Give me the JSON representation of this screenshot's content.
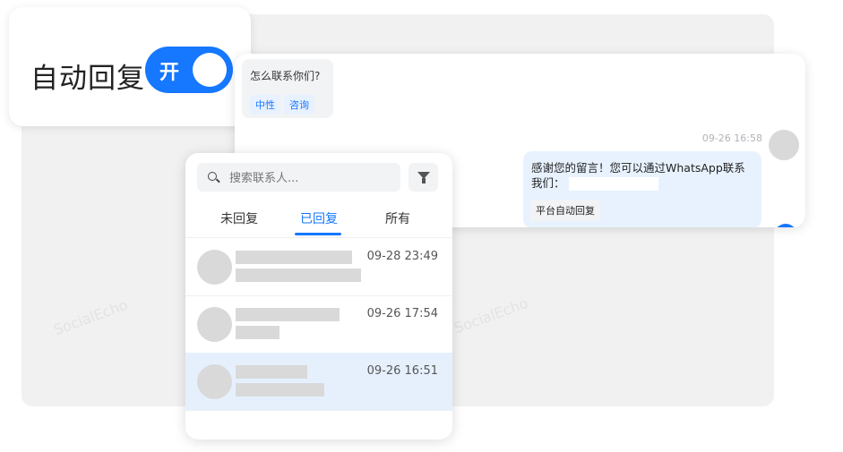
{
  "watermark": "SocialEcho",
  "auto_reply": {
    "title": "自动回复",
    "toggle_state": "开",
    "enabled": true
  },
  "chat": {
    "incoming_message": "怎么联系你们?",
    "tags": [
      "中性",
      "咨询"
    ],
    "timestamp": "09-26 16:58",
    "outgoing_message": "感谢您的留言！您可以通过WhatsApp联系我们：",
    "platform_tag": "平台自动回复"
  },
  "contacts": {
    "search_placeholder": "搜索联系人...",
    "tabs": [
      {
        "label": "未回复",
        "active": false
      },
      {
        "label": "已回复",
        "active": true
      },
      {
        "label": "所有",
        "active": false
      }
    ],
    "items": [
      {
        "time": "09-28 23:49",
        "selected": false
      },
      {
        "time": "09-26 17:54",
        "selected": false
      },
      {
        "time": "09-26 16:51",
        "selected": true
      }
    ]
  },
  "colors": {
    "accent": "#1677ff",
    "selected_row": "#e6f0fd",
    "panel_bg": "#f1f1f1"
  }
}
